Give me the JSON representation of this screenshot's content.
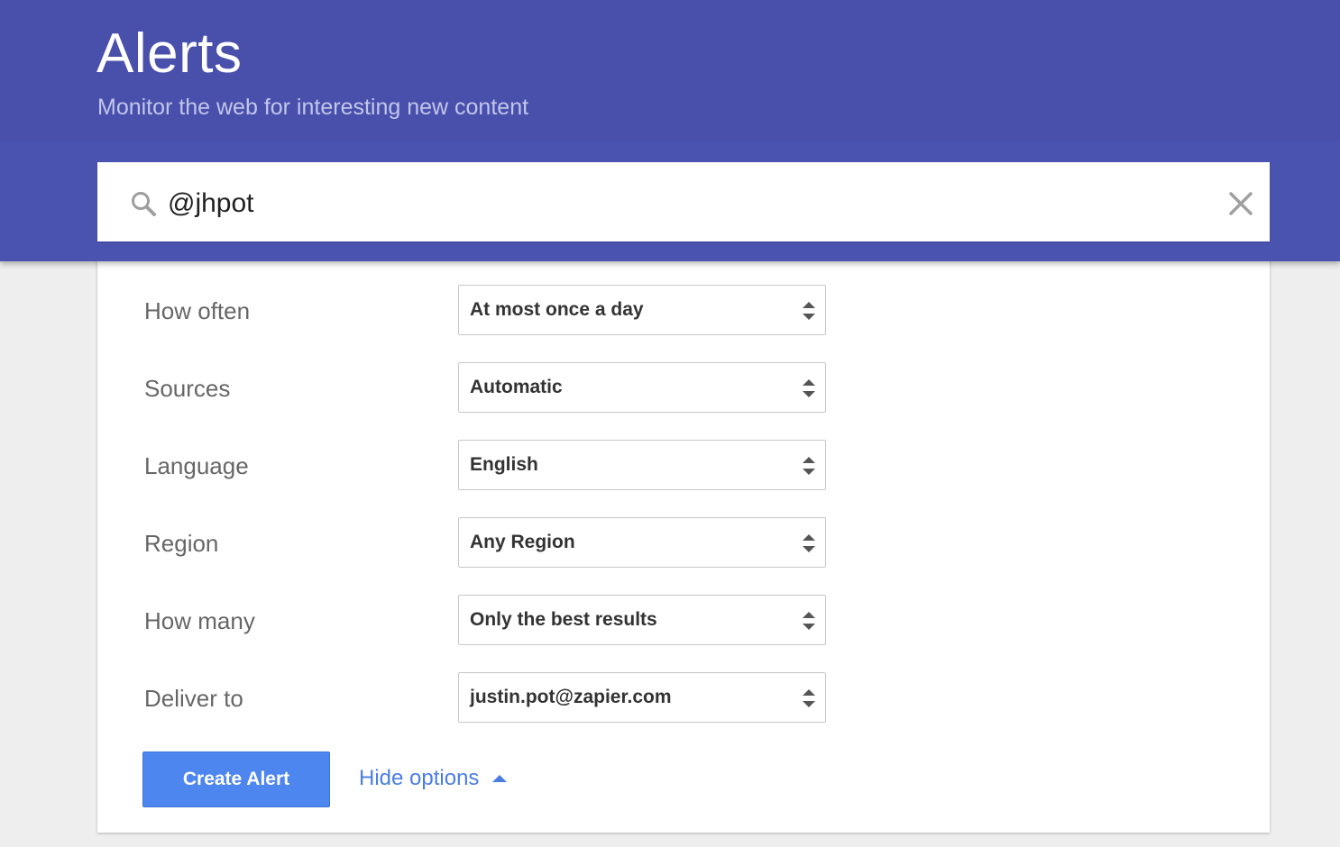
{
  "header": {
    "title": "Alerts",
    "subtitle": "Monitor the web for interesting new content"
  },
  "search": {
    "value": "@jhpot",
    "icon": "search-icon",
    "clear_icon": "close-icon"
  },
  "options": [
    {
      "label": "How often",
      "value": "At most once a day"
    },
    {
      "label": "Sources",
      "value": "Automatic"
    },
    {
      "label": "Language",
      "value": "English"
    },
    {
      "label": "Region",
      "value": "Any Region"
    },
    {
      "label": "How many",
      "value": "Only the best results"
    },
    {
      "label": "Deliver to",
      "value": "justin.pot@zapier.com"
    }
  ],
  "actions": {
    "create_label": "Create Alert",
    "hide_options_label": "Hide options"
  },
  "colors": {
    "header": "#4a52ae",
    "subtitle": "#c2c6ea",
    "button": "#4d86ef",
    "link": "#4a7ee3",
    "background": "#eeeeee"
  }
}
